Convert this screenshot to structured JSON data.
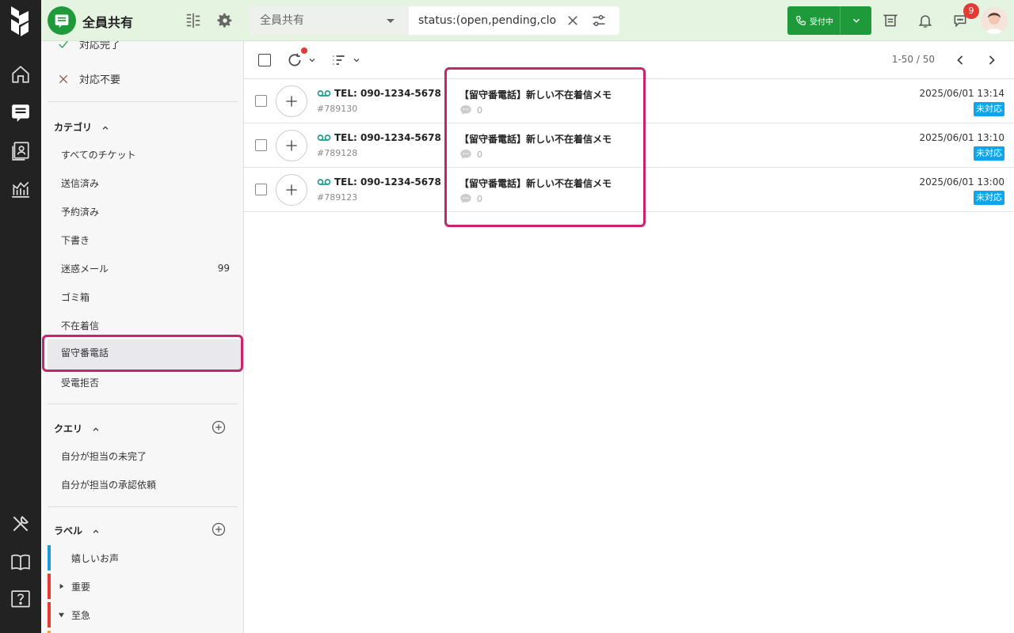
{
  "header": {
    "inbox_title": "全員共有",
    "search_scope": "全員共有",
    "search_query": "status:(open,pending,clo",
    "status_label": "受付中",
    "notification_count": "9"
  },
  "sidebar": {
    "top_items": [
      {
        "label": "対応完了"
      },
      {
        "label": "対応不要"
      }
    ],
    "category_title": "カテゴリ",
    "categories": [
      {
        "label": "すべてのチケット",
        "count": ""
      },
      {
        "label": "送信済み",
        "count": ""
      },
      {
        "label": "予約済み",
        "count": ""
      },
      {
        "label": "下書き",
        "count": ""
      },
      {
        "label": "迷惑メール",
        "count": "99"
      },
      {
        "label": "ゴミ箱",
        "count": ""
      },
      {
        "label": "不在着信",
        "count": ""
      },
      {
        "label": "留守番電話",
        "count": ""
      },
      {
        "label": "受電拒否",
        "count": ""
      }
    ],
    "query_title": "クエリ",
    "queries": [
      {
        "label": "自分が担当の未完了"
      },
      {
        "label": "自分が担当の承認依頼"
      }
    ],
    "label_title": "ラベル",
    "labels": [
      {
        "label": "嬉しいお声",
        "color": "#1e9bd7"
      },
      {
        "label": "重要",
        "color": "#e53935"
      },
      {
        "label": "至急",
        "color": "#e53935"
      }
    ]
  },
  "toolbar": {
    "pager": "1-50 / 50"
  },
  "tickets": [
    {
      "from": "TEL: 090-1234-5678",
      "id": "#789130",
      "subject": "【留守番電話】新しい不在着信メモ",
      "comments": "0",
      "date": "2025/06/01 13:14",
      "status": "未対応"
    },
    {
      "from": "TEL: 090-1234-5678",
      "id": "#789128",
      "subject": "【留守番電話】新しい不在着信メモ",
      "comments": "0",
      "date": "2025/06/01 13:10",
      "status": "未対応"
    },
    {
      "from": "TEL: 090-1234-5678",
      "id": "#789123",
      "subject": "【留守番電話】新しい不在着信メモ",
      "comments": "0",
      "date": "2025/06/01 13:00",
      "status": "未対応"
    }
  ],
  "colors": {
    "brand_green": "#1f9a3a",
    "highlight": "#c8246b",
    "status_badge": "#0ea5e9"
  }
}
